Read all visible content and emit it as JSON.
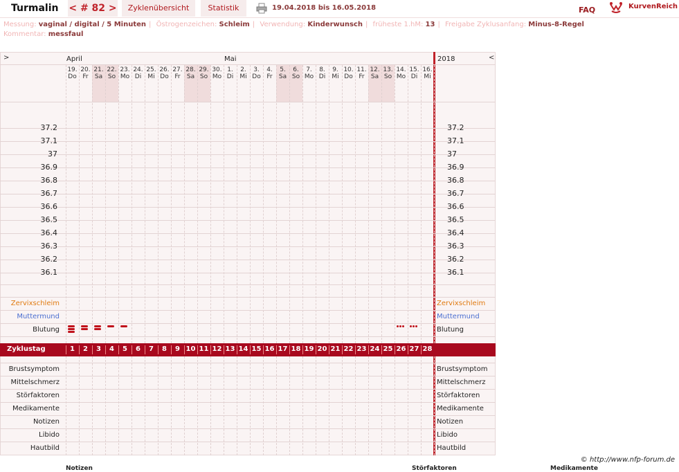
{
  "header": {
    "title": "Turmalin",
    "cycle_nav": "< # 82 >",
    "tab_overview": "Zyklenübersicht",
    "tab_stats": "Statistik",
    "date_range": "19.04.2018 bis 16.05.2018",
    "faq": "FAQ",
    "brand": "KurvenReich"
  },
  "info": {
    "messung_label": "Messung:",
    "messung_value": "vaginal / digital / 5 Minuten",
    "oestrogen_label": "Östrogenzeichen:",
    "oestrogen_value": "Schleim",
    "verwendung_label": "Verwendung:",
    "verwendung_value": "Kinderwunsch",
    "hm_label": "früheste 1.hM:",
    "hm_value": "13",
    "freigabe_label": "Freigabe Zyklusanfang:",
    "freigabe_value": "Minus-8-Regel",
    "kommentar_label": "Kommentar:",
    "kommentar_value": "messfaul"
  },
  "chart": {
    "prev_arrow": ">",
    "next_arrow": "<",
    "month_april": "April",
    "month_mai": "Mai",
    "year": "2018",
    "days": [
      {
        "d": "19.",
        "w": "Do"
      },
      {
        "d": "20.",
        "w": "Fr"
      },
      {
        "d": "21.",
        "w": "Sa"
      },
      {
        "d": "22.",
        "w": "So"
      },
      {
        "d": "23.",
        "w": "Mo"
      },
      {
        "d": "24.",
        "w": "Di"
      },
      {
        "d": "25.",
        "w": "Mi"
      },
      {
        "d": "26.",
        "w": "Do"
      },
      {
        "d": "27.",
        "w": "Fr"
      },
      {
        "d": "28.",
        "w": "Sa"
      },
      {
        "d": "29.",
        "w": "So"
      },
      {
        "d": "30.",
        "w": "Mo"
      },
      {
        "d": "1.",
        "w": "Di"
      },
      {
        "d": "2.",
        "w": "Mi"
      },
      {
        "d": "3.",
        "w": "Do"
      },
      {
        "d": "4.",
        "w": "Fr"
      },
      {
        "d": "5.",
        "w": "Sa"
      },
      {
        "d": "6.",
        "w": "So"
      },
      {
        "d": "7.",
        "w": "Mo"
      },
      {
        "d": "8.",
        "w": "Di"
      },
      {
        "d": "9.",
        "w": "Mi"
      },
      {
        "d": "10.",
        "w": "Do"
      },
      {
        "d": "11.",
        "w": "Fr"
      },
      {
        "d": "12.",
        "w": "Sa"
      },
      {
        "d": "13.",
        "w": "So"
      },
      {
        "d": "14.",
        "w": "Mo"
      },
      {
        "d": "15.",
        "w": "Di"
      },
      {
        "d": "16.",
        "w": "Mi"
      }
    ],
    "temps": [
      "37.2",
      "37.1",
      "37",
      "36.9",
      "36.8",
      "36.7",
      "36.6",
      "36.5",
      "36.4",
      "36.3",
      "36.2",
      "36.1"
    ],
    "row_zervix": "Zervixschleim",
    "row_muttermund": "Muttermund",
    "row_blutung": "Blutung",
    "zyklustag_label": "Zyklustag",
    "zyklustage": [
      "1",
      "2",
      "3",
      "4",
      "5",
      "6",
      "7",
      "8",
      "9",
      "10",
      "11",
      "12",
      "13",
      "14",
      "15",
      "16",
      "17",
      "18",
      "19",
      "20",
      "21",
      "22",
      "23",
      "24",
      "25",
      "26",
      "27",
      "28"
    ],
    "bottom_rows": [
      "Brustsymptom",
      "Mittelschmerz",
      "Störfaktoren",
      "Medikamente",
      "Notizen",
      "Libido",
      "Hautbild"
    ],
    "colors": {
      "zervix": "#e07a10",
      "muttermund": "#4a6ed0",
      "accent": "#a8091e"
    }
  },
  "footer": {
    "copyright": "© http://www.nfp-forum.de",
    "bottom_notizen": "Notizen",
    "bottom_stoer": "Störfaktoren",
    "bottom_medi": "Medikamente"
  }
}
